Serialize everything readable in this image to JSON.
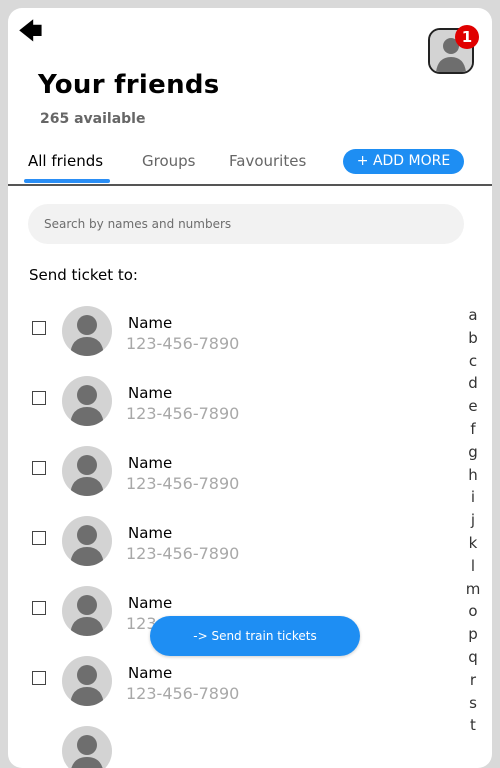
{
  "header": {
    "back_icon": "arrow-left-icon",
    "title": "Your friends",
    "subtitle": "265 available",
    "notification_count": "1"
  },
  "tabs": [
    {
      "label": "All friends",
      "active": true
    },
    {
      "label": "Groups",
      "active": false
    },
    {
      "label": "Favourites",
      "active": false
    }
  ],
  "add_more_label": "+ ADD MORE",
  "search": {
    "placeholder": "Search by names and numbers",
    "value": ""
  },
  "send_label": "Send ticket to:",
  "friends": [
    {
      "name": "Name",
      "phone": "123-456-7890",
      "checked": false
    },
    {
      "name": "Name",
      "phone": "123-456-7890",
      "checked": false
    },
    {
      "name": "Name",
      "phone": "123-456-7890",
      "checked": false
    },
    {
      "name": "Name",
      "phone": "123-456-7890",
      "checked": false
    },
    {
      "name": "Name",
      "phone": "123-456-7890",
      "checked": false
    },
    {
      "name": "Name",
      "phone": "123-456-7890",
      "checked": false
    }
  ],
  "alphabet": [
    "a",
    "b",
    "c",
    "d",
    "e",
    "f",
    "g",
    "h",
    "i",
    "j",
    "k",
    "l",
    "m",
    "o",
    "p",
    "q",
    "r",
    "s",
    "t"
  ],
  "send_button_label": "->  Send train tickets",
  "colors": {
    "accent": "#1e8ef3",
    "badge": "#e00000"
  }
}
